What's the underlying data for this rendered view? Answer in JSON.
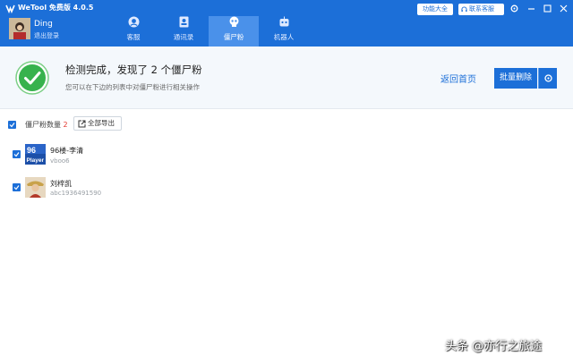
{
  "app": {
    "title": "WeTool 免费版 4.0.5"
  },
  "titlebar": {
    "features_label": "功能大全",
    "service_label": "联系客服"
  },
  "user": {
    "name": "Ding",
    "logout_label": "退出登录"
  },
  "nav": {
    "tabs": [
      {
        "label": "客服"
      },
      {
        "label": "通讯录"
      },
      {
        "label": "僵尸粉"
      },
      {
        "label": "机器人"
      }
    ],
    "active_index": 2
  },
  "result": {
    "title": "检测完成，发现了 2 个僵尸粉",
    "subtitle": "您可以在下边的列表中对僵尸粉进行相关操作",
    "back_label": "返回首页",
    "batch_delete_label": "批量删除"
  },
  "list": {
    "count_label": "僵尸粉数量",
    "count": "2",
    "export_label": "全部导出",
    "rows": [
      {
        "name": "96楼-李清",
        "id": "vboo6"
      },
      {
        "name": "刘梓凯",
        "id": "abc1936491590"
      }
    ]
  },
  "watermark": {
    "text": "头条 @亦行之旅途"
  },
  "colors": {
    "primary": "#1c6fd8",
    "active_tab": "#4a91ea",
    "success": "#37b24d",
    "count": "#e3382f"
  }
}
